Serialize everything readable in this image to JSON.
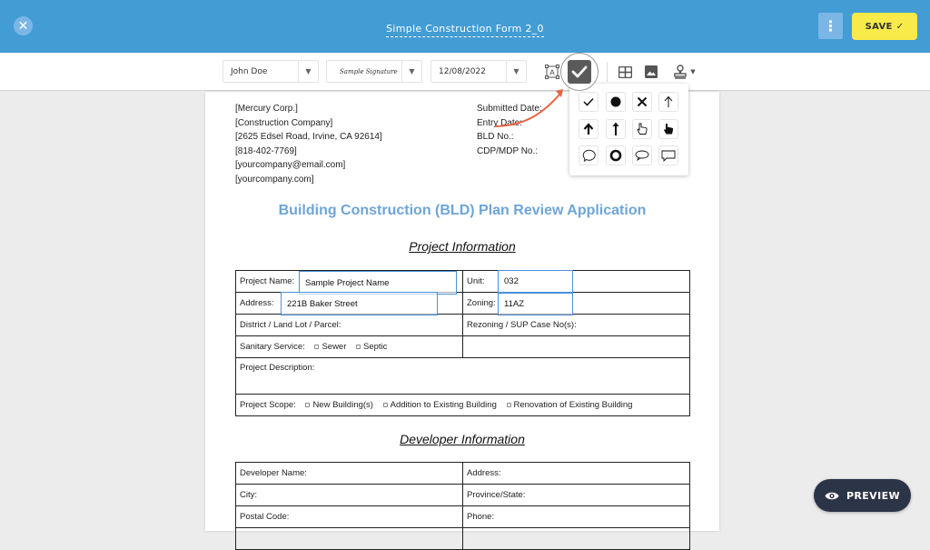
{
  "header": {
    "title": "Simple Construction Form 2_0",
    "save_label": "SAVE",
    "save_icon": "check-icon",
    "close_icon": "close-icon",
    "more_icon": "more-vertical-icon"
  },
  "toolbar": {
    "name_select": "John Doe",
    "signature_select": "Sample Signature",
    "date_select": "12/08/2022",
    "tools": [
      "text-field-icon",
      "checkmark-stamp-icon",
      "table-icon",
      "image-icon",
      "stamp-icon"
    ]
  },
  "stamp_popup": {
    "items": [
      "checkmark",
      "filled-circle",
      "cross",
      "arrow-up-thin",
      "arrow-up-bold",
      "arrow-up-long",
      "hand-pointer-outline",
      "hand-pointer-filled",
      "speech-bubble-round",
      "ring",
      "speech-bubble-oval",
      "speech-bubble-rect"
    ]
  },
  "document": {
    "company_lines": [
      "[Mercury Corp.]",
      "[Construction Company]",
      "[2625 Edsel Road, Irvine, CA 92614]",
      "[818-402-7769]",
      "[yourcompany@email.com]",
      "[yourcompany.com]"
    ],
    "meta_lines": [
      "Submitted Date:",
      "Entry Date:",
      "BLD No.:",
      "CDP/MDP No.:"
    ],
    "title": "Building Construction (BLD) Plan Review Application",
    "project_section": "Project Information",
    "project": {
      "project_name_label": "Project Name:",
      "unit_label": "Unit:",
      "address_label": "Address:",
      "zoning_label": "Zoning:",
      "district_label": "District / Land Lot / Parcel:",
      "rezoning_label": "Rezoning / SUP Case No(s):",
      "sanitary_label": "Sanitary Service:",
      "sanitary_options": [
        "Sewer",
        "Septic"
      ],
      "description_label": "Project Description:",
      "scope_label": "Project Scope:",
      "scope_options": [
        "New Building(s)",
        "Addition to Existing Building",
        "Renovation of Existing Building"
      ]
    },
    "fields": {
      "project_name": "Sample Project Name",
      "unit": "032",
      "address": "221B Baker Street",
      "zoning": "11AZ"
    },
    "developer_section": "Developer Information",
    "developer": {
      "name_label": "Developer Name:",
      "address_label": "Address:",
      "city_label": "City:",
      "province_label": "Province/State:",
      "postal_label": "Postal Code:",
      "phone_label": "Phone:"
    }
  },
  "preview": {
    "label": "PREVIEW",
    "icon": "eye-icon"
  },
  "colors": {
    "header": "#439cd4",
    "save": "#f8ea48",
    "title_blue": "#6ea5d9",
    "field_border": "#4a90d9",
    "preview_bg": "#2c3447",
    "annotation_arrow": "#e8623f"
  }
}
